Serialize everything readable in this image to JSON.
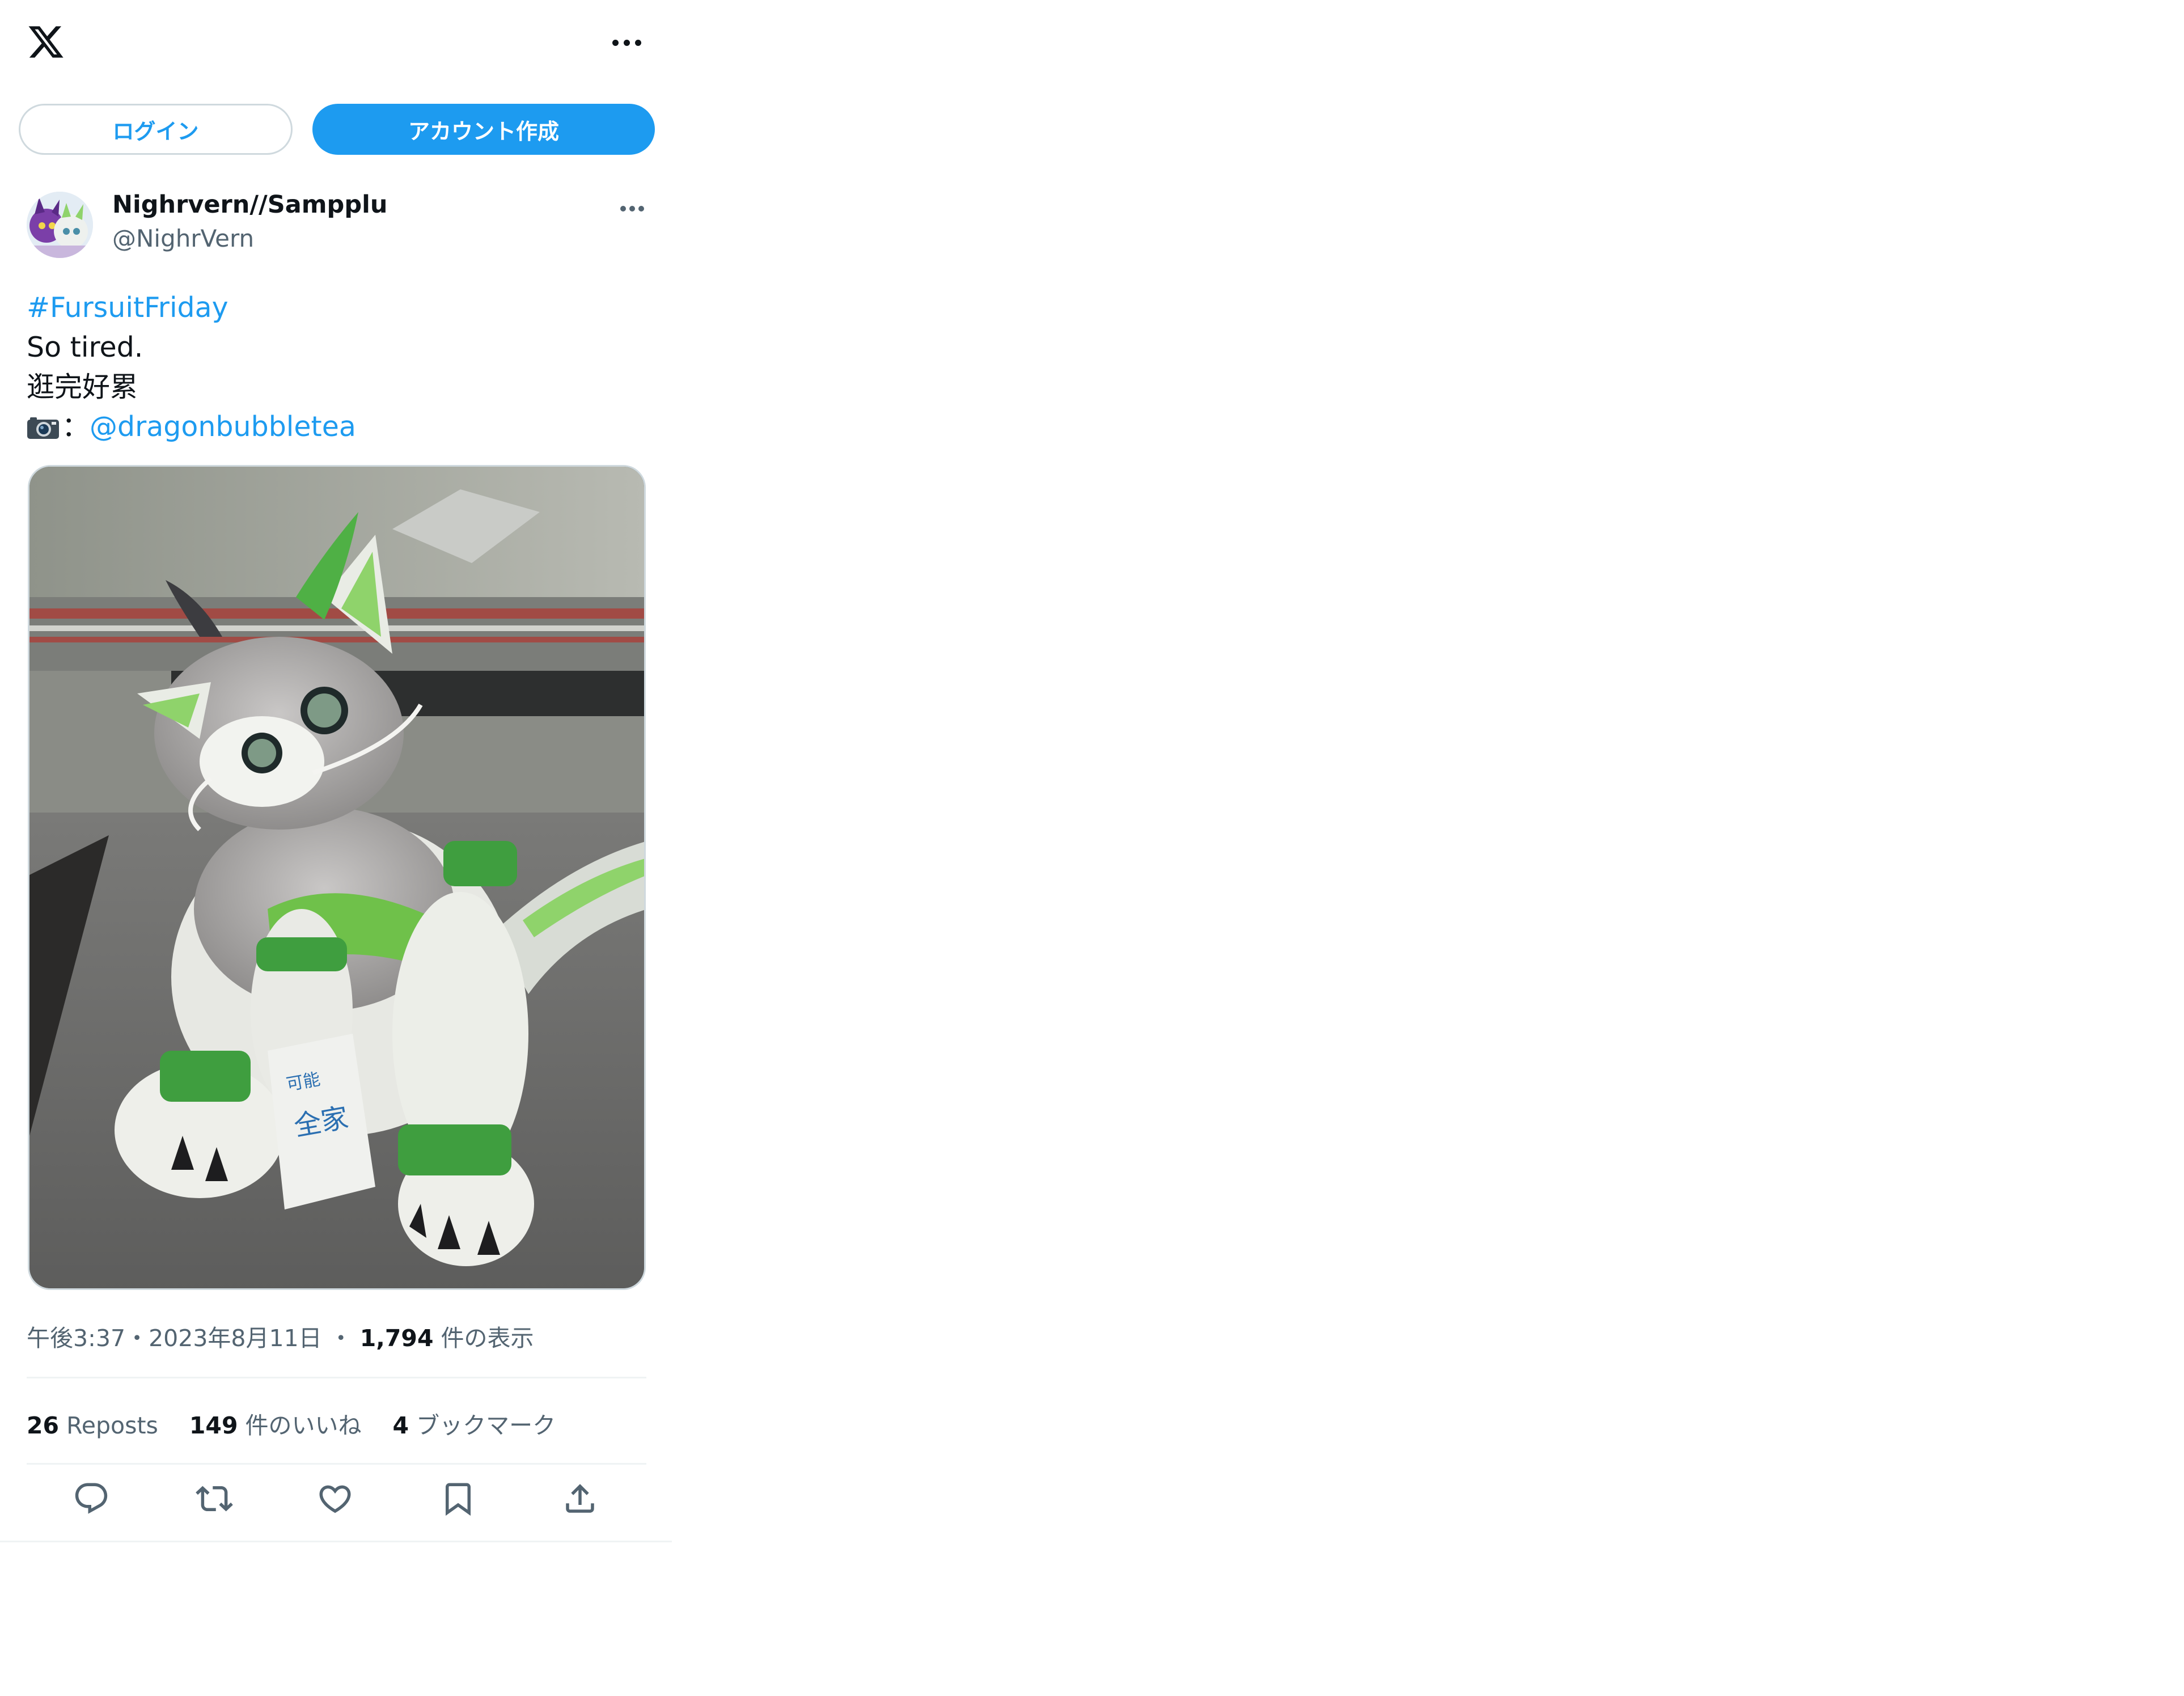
{
  "header": {
    "logo_icon": "x-logo-icon",
    "more_icon": "more-horizontal-icon"
  },
  "auth": {
    "login_label": "ログイン",
    "signup_label": "アカウント作成"
  },
  "tweet": {
    "author": {
      "display_name": "Nighrvern//Sampplu",
      "handle": "@NighrVern"
    },
    "text": {
      "hashtag": "#FursuitFriday",
      "line2": "So tired.",
      "line3": "逛完好累",
      "camera_emoji": "camera-icon",
      "separator": "：",
      "mention": "@dragonbubbletea"
    },
    "meta": {
      "time": "午後3:37",
      "dot1": "・",
      "date": "2023年8月11日",
      "dot2": "・",
      "views_count": "1,794",
      "views_label": "件の表示"
    },
    "stats": {
      "reposts_count": "26",
      "reposts_label": "Reposts",
      "likes_count": "149",
      "likes_label": "件のいいね",
      "bookmarks_count": "4",
      "bookmarks_label": "ブックマーク"
    },
    "actions": [
      "reply-icon",
      "repost-icon",
      "like-icon",
      "bookmark-icon",
      "share-icon"
    ]
  },
  "colors": {
    "accent": "#1d9bf0",
    "text_primary": "#0f1419",
    "text_secondary": "#536471",
    "border": "#cfd9de"
  }
}
